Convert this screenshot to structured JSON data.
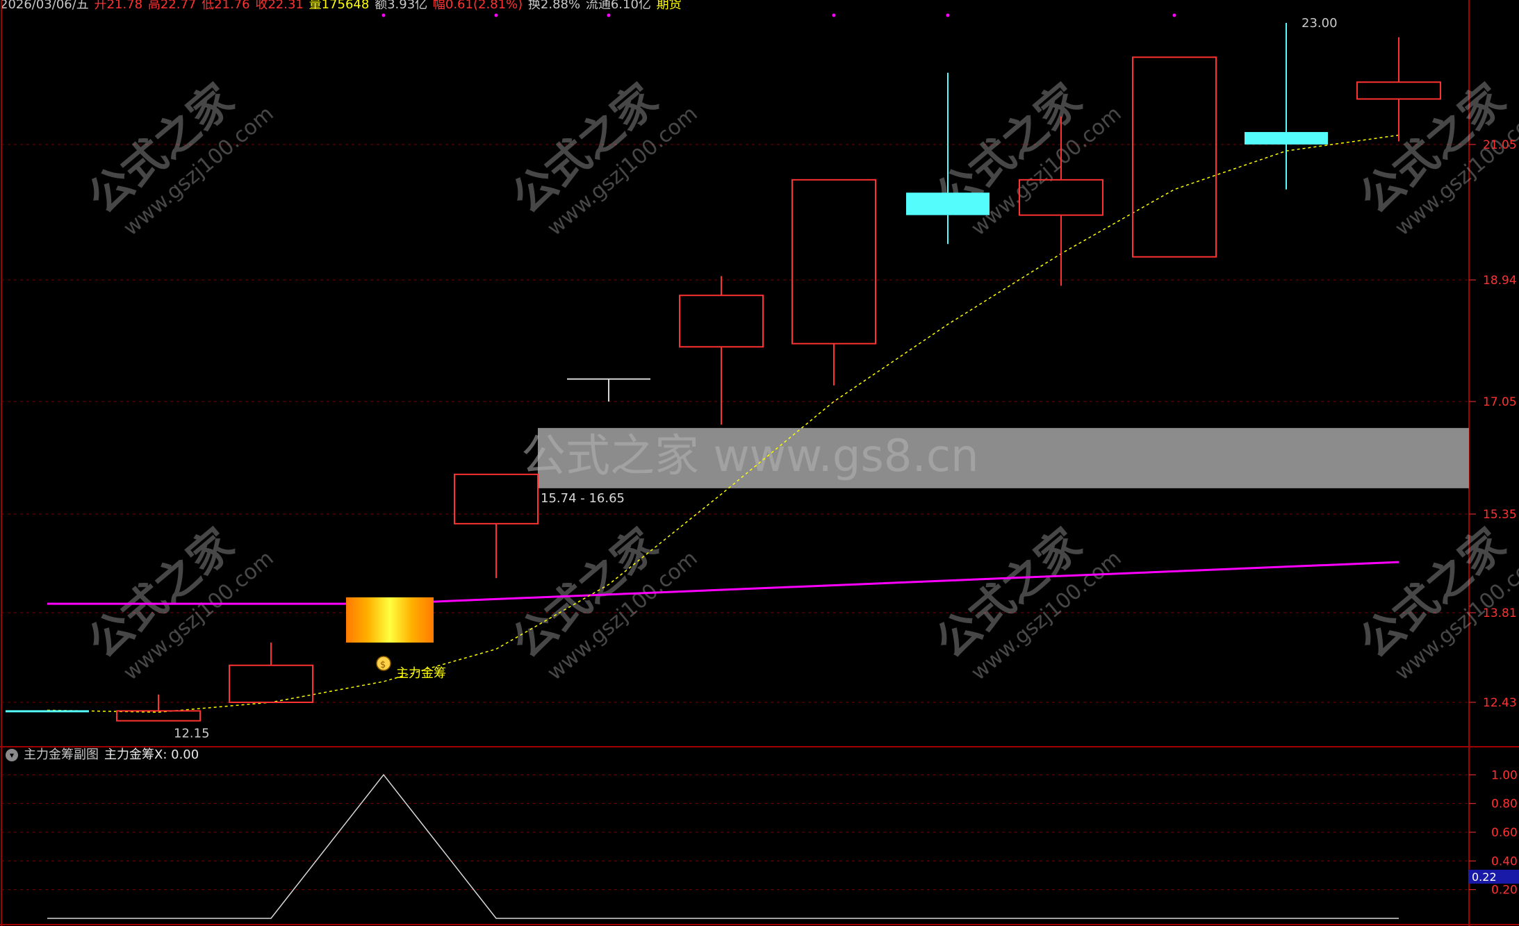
{
  "header": {
    "date": "2026/03/06/五",
    "open_label": "开",
    "open": "21.78",
    "high_label": "高",
    "high": "22.77",
    "low_label": "低",
    "low": "21.76",
    "close_label": "收",
    "close": "22.31",
    "volume_label": "量",
    "volume": "175648",
    "amount_label": "额",
    "amount": "3.93亿",
    "change_label": "幅",
    "change": "0.61(2.81%)",
    "turnover_label": "换",
    "turnover": "2.88%",
    "float_label": "流通",
    "float": "6.10亿",
    "futures_label": "期货"
  },
  "watermark": {
    "site_cn": "公式之家",
    "site_url": "www.gszj100.com",
    "banner": "公式之家 www.gs8.cn"
  },
  "main_chart": {
    "price_axis": [
      "21.05",
      "18.94",
      "17.05",
      "15.35",
      "13.81",
      "12.43"
    ],
    "high_marker": "23.00",
    "low_marker": "12.15",
    "zone_label": "15.74 - 16.65",
    "signal_label": "主力金筹",
    "colors": {
      "up": "#ff3232",
      "down": "#54fcfc",
      "ma_yellow": "#ffff00",
      "ma_magenta": "#ff00ff",
      "grid": "#8b0000",
      "axis_text": "#ff3232"
    }
  },
  "sub_chart": {
    "title": "主力金筹副图",
    "series_label": "主力金筹X: 0.00",
    "axis": [
      "1.00",
      "0.80",
      "0.60",
      "0.40",
      "0.20"
    ],
    "current_value": "0.22"
  },
  "chart_data": {
    "type": "candlestick",
    "candles": [
      {
        "open": 12.31,
        "close": 12.31,
        "high": 12.31,
        "low": 12.31,
        "dir": "down"
      },
      {
        "open": 12.15,
        "close": 12.3,
        "high": 12.55,
        "low": 12.15,
        "dir": "up"
      },
      {
        "open": 12.43,
        "close": 13.0,
        "high": 13.35,
        "low": 12.43,
        "dir": "up"
      },
      {
        "open": 13.35,
        "close": 14.05,
        "high": 14.05,
        "low": 13.35,
        "dir": "signal"
      },
      {
        "open": 15.2,
        "close": 15.95,
        "high": 15.95,
        "low": 14.35,
        "dir": "up"
      },
      {
        "open": 17.4,
        "close": 17.4,
        "high": 17.4,
        "low": 17.05,
        "dir": "doji"
      },
      {
        "open": 17.9,
        "close": 18.7,
        "high": 19.0,
        "low": 16.7,
        "dir": "up"
      },
      {
        "open": 17.95,
        "close": 20.5,
        "high": 20.5,
        "low": 17.3,
        "dir": "up"
      },
      {
        "open": 20.3,
        "close": 19.95,
        "high": 22.2,
        "low": 19.5,
        "dir": "down"
      },
      {
        "open": 19.95,
        "close": 20.5,
        "high": 21.5,
        "low": 18.85,
        "dir": "up"
      },
      {
        "open": 19.3,
        "close": 22.45,
        "high": 22.45,
        "low": 19.3,
        "dir": "up"
      },
      {
        "open": 21.25,
        "close": 21.05,
        "high": 23.0,
        "low": 20.35,
        "dir": "down"
      },
      {
        "open": 21.78,
        "close": 22.05,
        "high": 22.77,
        "low": 21.1,
        "dir": "up"
      }
    ],
    "ma_yellow": [
      12.31,
      12.28,
      12.43,
      12.75,
      13.25,
      14.25,
      15.65,
      17.05,
      18.25,
      19.35,
      20.35,
      20.95,
      21.2
    ],
    "ma_magenta_start": 13.95,
    "ma_magenta_end": 14.6,
    "zone": [
      15.74,
      16.65
    ],
    "sub_series": [
      0,
      0,
      0,
      1.0,
      0,
      0,
      0,
      0,
      0,
      0,
      0,
      0,
      0
    ],
    "sub_ylim": [
      0,
      1.05
    ]
  }
}
